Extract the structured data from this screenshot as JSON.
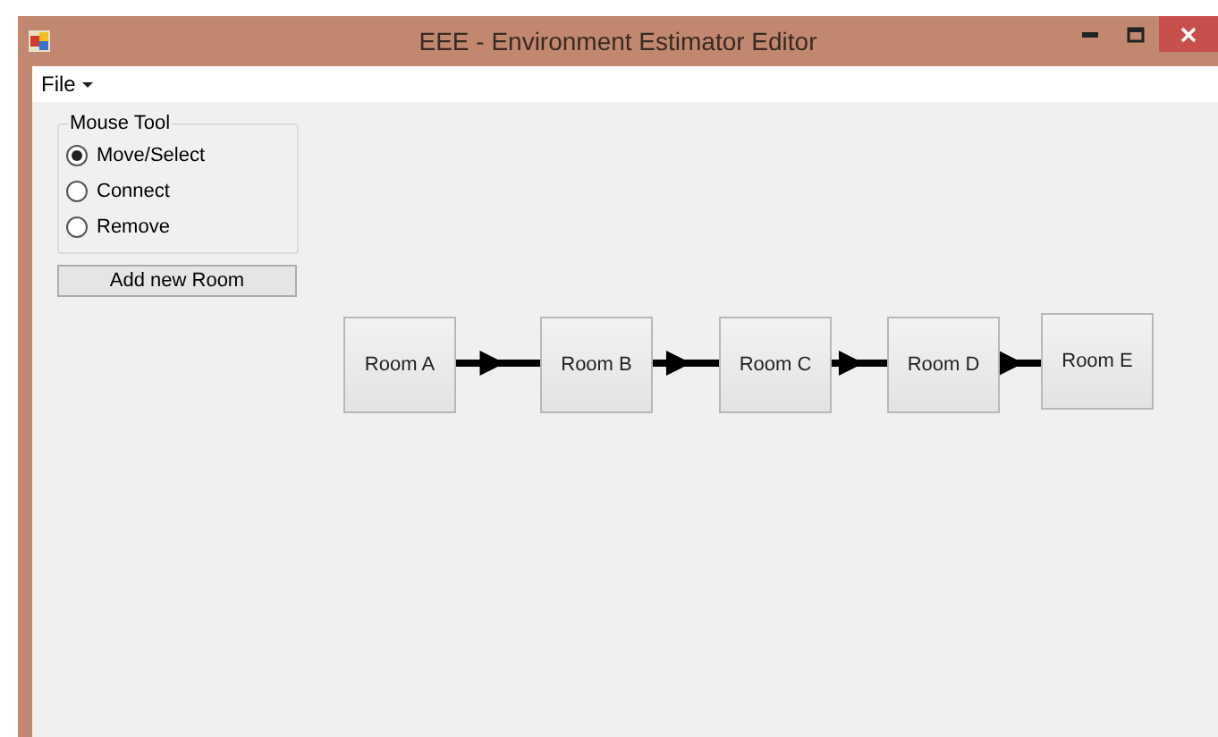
{
  "window": {
    "title": "EEE - Environment Estimator Editor"
  },
  "menu": [
    {
      "label": "File"
    }
  ],
  "mouse_tool": {
    "title": "Mouse Tool",
    "options": [
      {
        "label": "Move/Select",
        "selected": true
      },
      {
        "label": "Connect",
        "selected": false
      },
      {
        "label": "Remove",
        "selected": false
      }
    ]
  },
  "add_button": "Add new Room",
  "rooms": [
    {
      "label": "Room A"
    },
    {
      "label": "Room B"
    },
    {
      "label": "Room C"
    },
    {
      "label": "Room D"
    },
    {
      "label": "Room E"
    }
  ]
}
